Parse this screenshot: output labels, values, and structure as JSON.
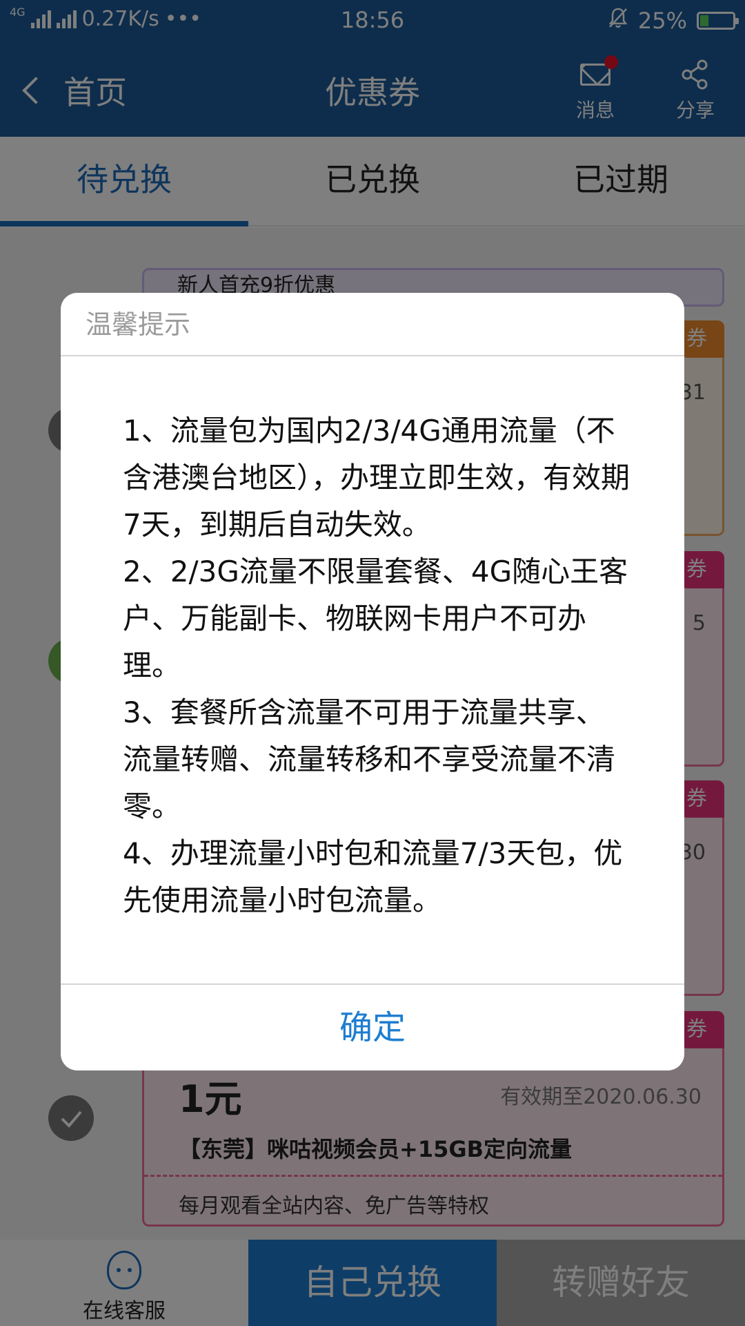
{
  "status_bar": {
    "network": "4G",
    "speed": "0.27K/s",
    "more": "•••",
    "time": "18:56",
    "battery": "25%",
    "battery_level": 0.25
  },
  "header": {
    "back_label": "首页",
    "title": "优惠券",
    "actions": [
      {
        "label": "消息",
        "icon": "mail-icon"
      },
      {
        "label": "分享",
        "icon": "share-icon"
      }
    ]
  },
  "tabs": [
    {
      "label": "待兑换",
      "active": true
    },
    {
      "label": "已兑换",
      "active": false
    },
    {
      "label": "已过期",
      "active": false
    }
  ],
  "coupons": [
    {
      "desc": "新人首充9折优惠"
    },
    {
      "badge": "券",
      "value_fragment": "31"
    },
    {
      "badge": "券",
      "value_fragment": "5"
    },
    {
      "badge": "券",
      "value_fragment": "30"
    },
    {
      "badge": "券",
      "price": "1元",
      "expiry": "有效期至2020.06.30",
      "name": "【东莞】咪咕视频会员+15GB定向流量",
      "desc": "每月观看全站内容、免广告等特权"
    }
  ],
  "dialog": {
    "title": "温馨提示",
    "items": [
      "1、流量包为国内2/3/4G通用流量（不含港澳台地区），办理立即生效，有效期7天，到期后自动失效。",
      "2、2/3G流量不限量套餐、4G随心王客户、万能副卡、物联网卡用户不可办理。",
      "3、套餐所含流量不可用于流量共享、流量转赠、流量转移和不享受流量不清零。",
      "4、办理流量小时包和流量7/3天包，优先使用流量小时包流量。"
    ],
    "confirm_label": "确定"
  },
  "bottom_bar": {
    "service_label": "在线客服",
    "self_redeem_label": "自己兑换",
    "gift_label": "转赠好友"
  },
  "colors": {
    "brand": "#1d5a98",
    "accent": "#1d7dd0",
    "coupon_pink": "#e8337a"
  }
}
